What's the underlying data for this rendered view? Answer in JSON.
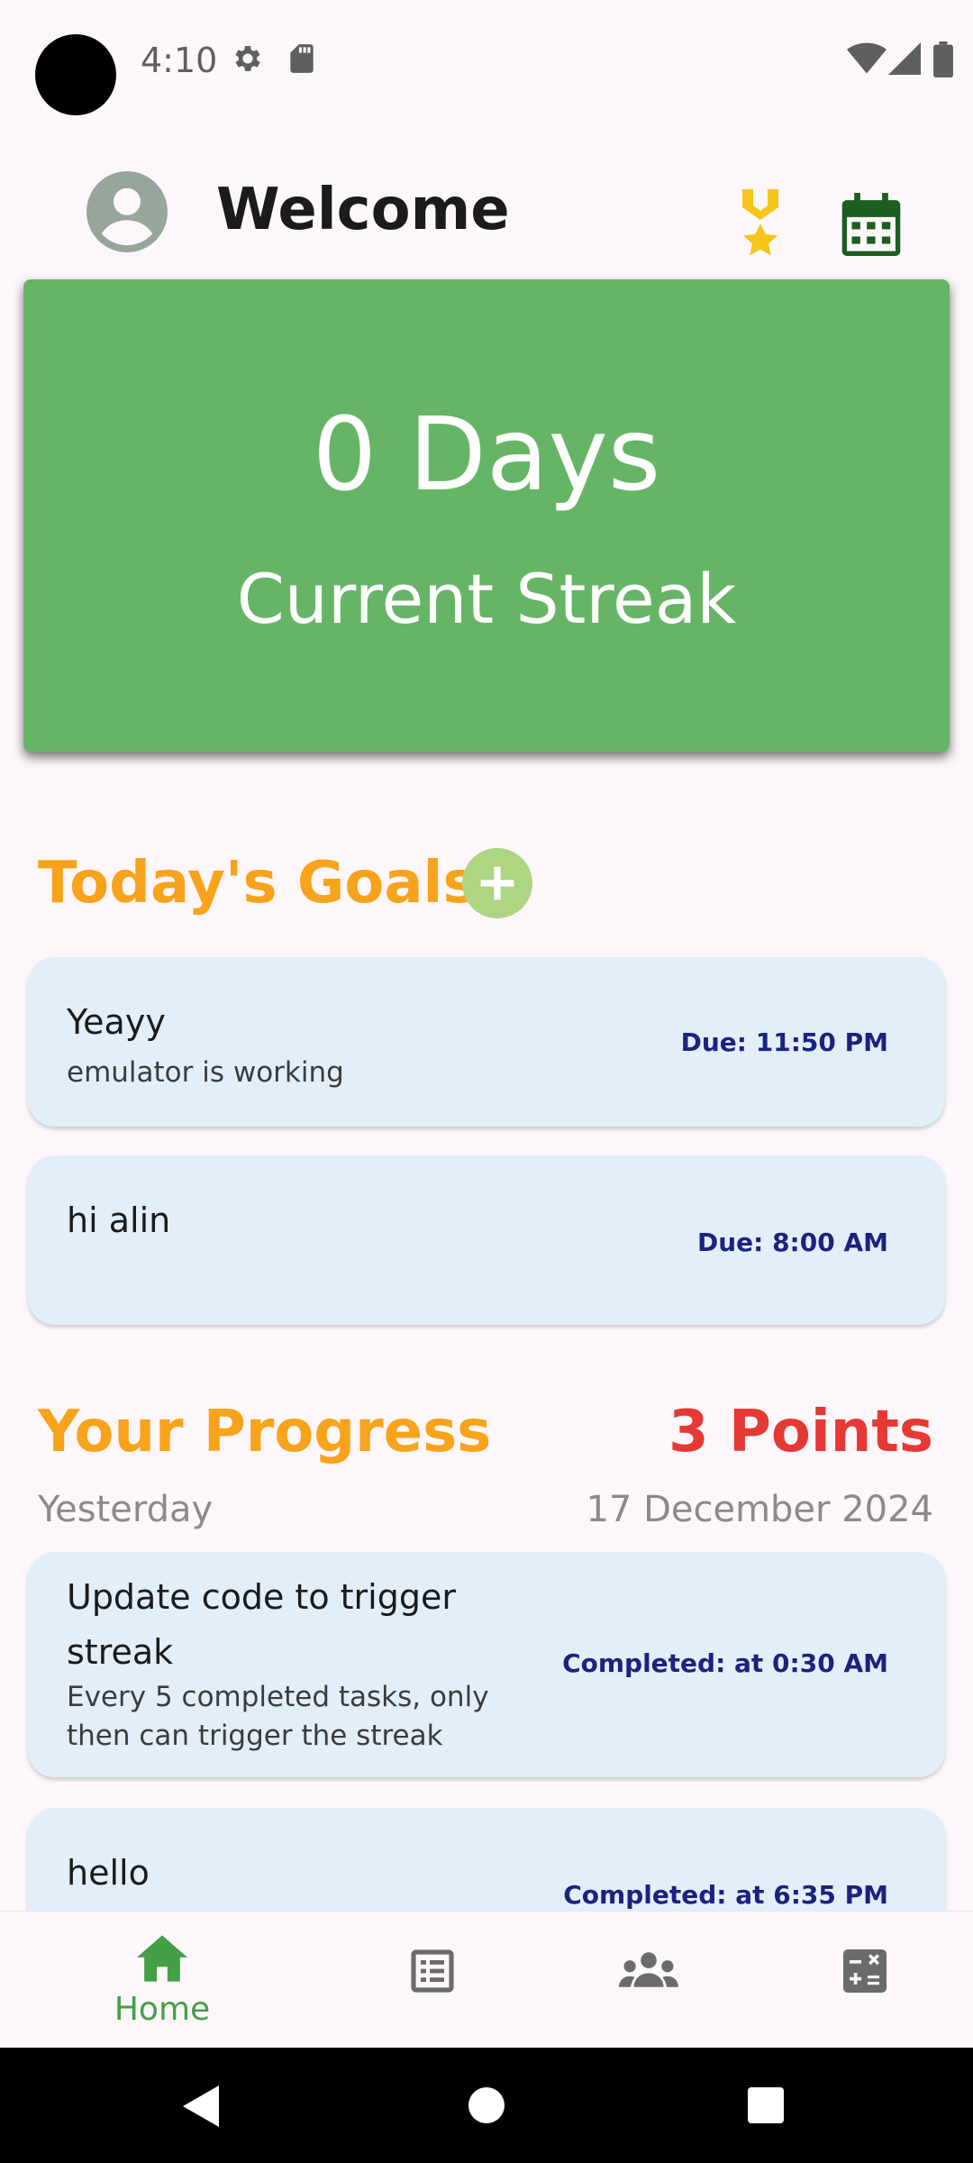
{
  "status_bar": {
    "time": "4:10"
  },
  "header": {
    "title": "Welcome"
  },
  "streak": {
    "days": "0 Days",
    "label": "Current Streak"
  },
  "goals": {
    "title": "Today's Goals",
    "items": [
      {
        "title": "Yeayy",
        "description": "emulator is working",
        "due": "Due: 11:50 PM"
      },
      {
        "title": "hi alin",
        "description": "",
        "due": "Due: 8:00 AM"
      }
    ]
  },
  "progress": {
    "title": "Your Progress",
    "points": "3 Points",
    "day_label": "Yesterday",
    "date": "17 December 2024",
    "items": [
      {
        "title_line1": "Update code to trigger",
        "title_line2": "streak",
        "description_line1": "Every 5 completed tasks, only",
        "description_line2": "then can trigger the streak",
        "completed": "Completed: at 0:30 AM"
      },
      {
        "title": "hello",
        "completed": "Completed: at 6:35 PM"
      }
    ]
  },
  "bottom_nav": {
    "home_label": "Home"
  },
  "colors": {
    "accent": "#f7a31b",
    "streak": "#66b566",
    "points": "#e53935",
    "nav_active": "#43a047",
    "card": "#e2eff9"
  },
  "icons": [
    "settings-icon",
    "sd-card-icon",
    "wifi-icon",
    "signal-icon",
    "battery-icon",
    "avatar-icon",
    "medal-icon",
    "calendar-icon",
    "add-icon",
    "home-icon",
    "list-icon",
    "people-icon",
    "calculator-icon",
    "back-icon",
    "home-circle-icon",
    "recents-icon"
  ]
}
